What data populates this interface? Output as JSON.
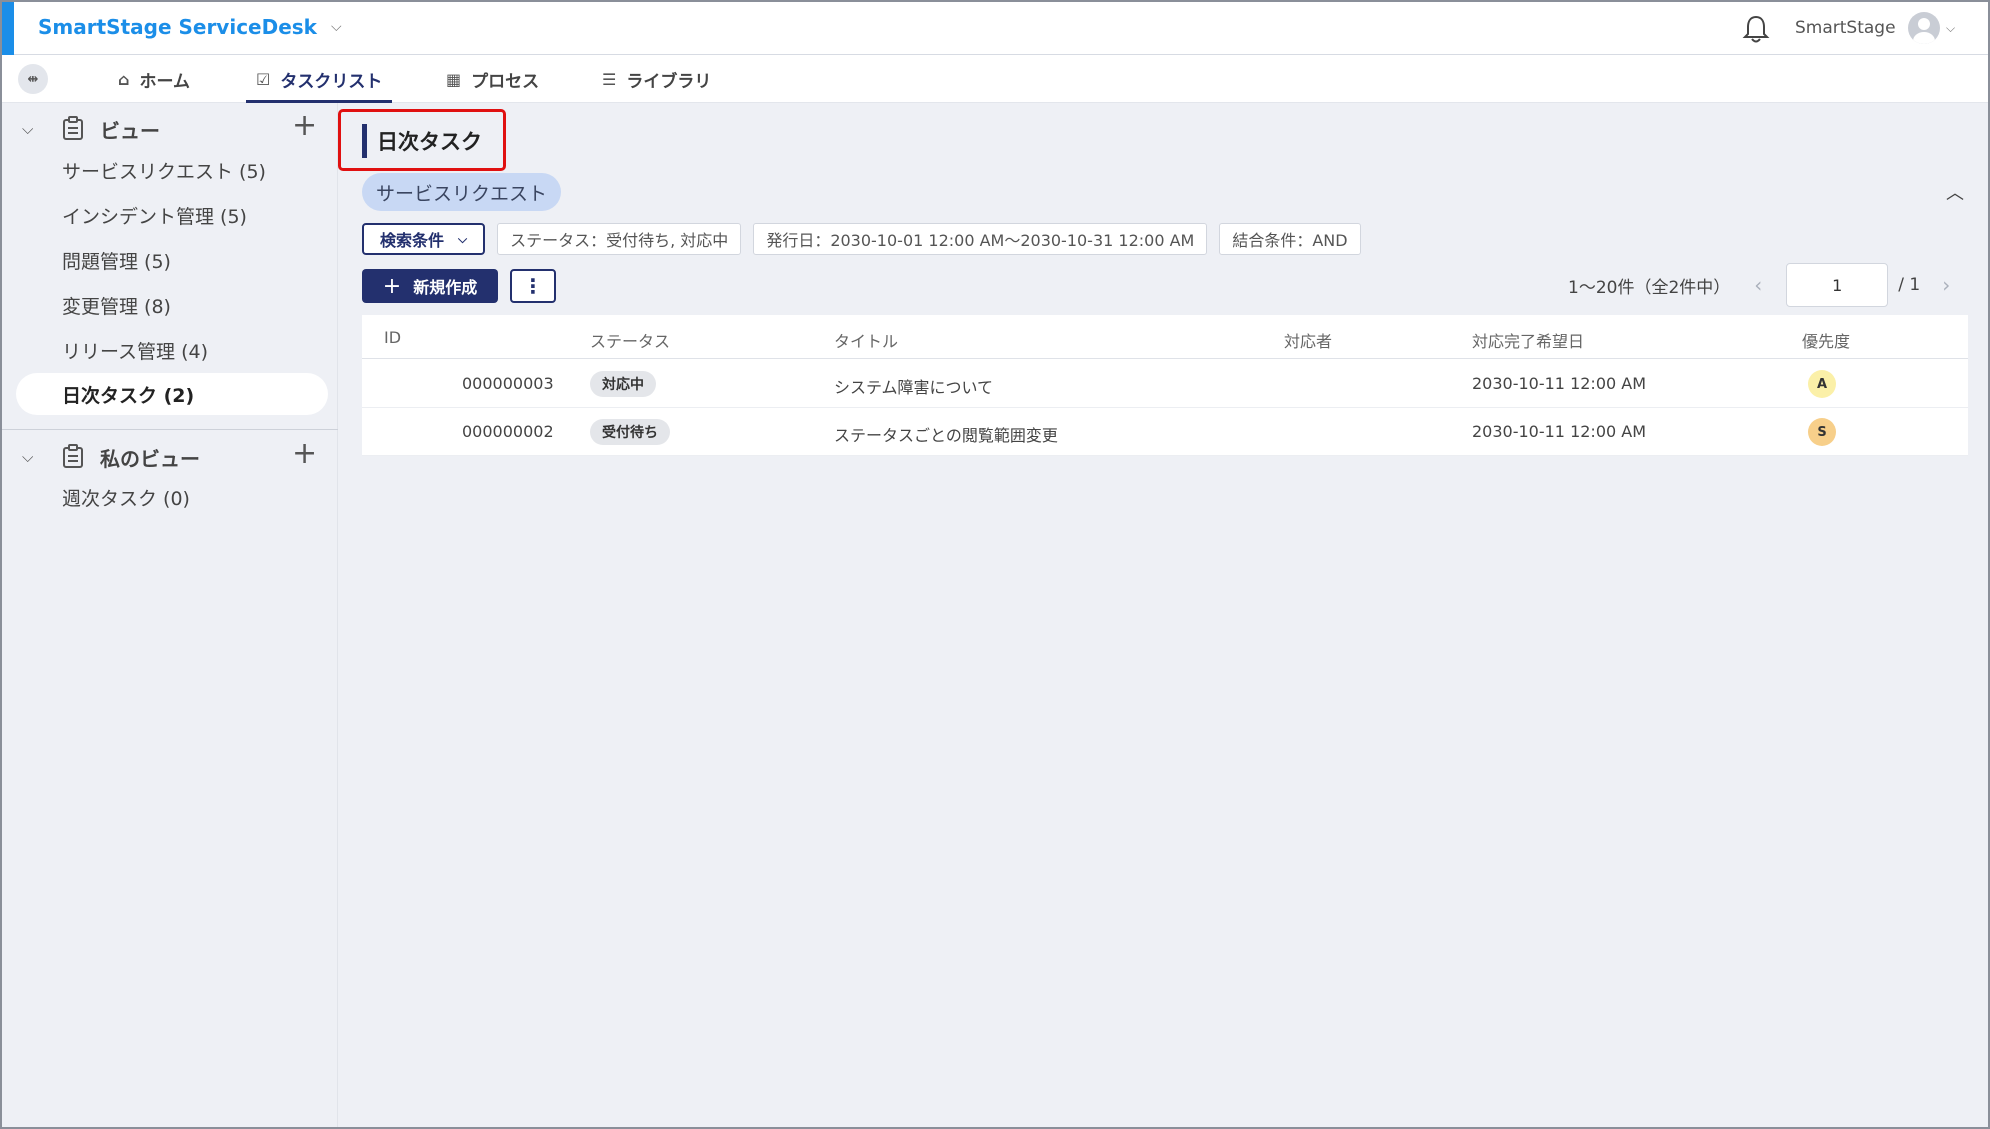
{
  "app": {
    "title": "SmartStage ServiceDesk",
    "user_name": "SmartStage"
  },
  "nav": {
    "tabs": [
      {
        "label": "ホーム",
        "icon": "home-icon"
      },
      {
        "label": "タスクリスト",
        "icon": "checklist-icon"
      },
      {
        "label": "プロセス",
        "icon": "building-icon"
      },
      {
        "label": "ライブラリ",
        "icon": "list-icon"
      }
    ]
  },
  "sidebar": {
    "views": {
      "label": "ビュー",
      "items": [
        {
          "label": "サービスリクエスト (5)"
        },
        {
          "label": "インシデント管理 (5)"
        },
        {
          "label": "問題管理 (5)"
        },
        {
          "label": "変更管理 (8)"
        },
        {
          "label": "リリース管理 (4)"
        },
        {
          "label": "日次タスク (2)"
        }
      ]
    },
    "my_views": {
      "label": "私のビュー",
      "items": [
        {
          "label": "週次タスク (0)"
        }
      ]
    }
  },
  "main": {
    "page_title": "日次タスク",
    "category_chip": "サービスリクエスト",
    "filters": {
      "search_label": "検索条件",
      "tags": [
        "ステータス：受付待ち, 対応中",
        "発行日：2030-10-01 12:00 AM〜2030-10-31 12:00 AM",
        "結合条件：AND"
      ]
    },
    "actions": {
      "new_label": "新規作成",
      "more_label": "⋮"
    },
    "pager": {
      "count": "1〜20件（全2件中）",
      "page": "1",
      "total": "/ 1"
    },
    "table": {
      "headers": [
        "ID",
        "ステータス",
        "タイトル",
        "対応者",
        "対応完了希望日",
        "優先度"
      ],
      "rows": [
        {
          "id": "000000003",
          "status": "対応中",
          "title": "システム障害について",
          "assignee": "",
          "due": "2030-10-11 12:00 AM",
          "priority": "A"
        },
        {
          "id": "000000002",
          "status": "受付待ち",
          "title": "ステータスごとの閲覧範囲変更",
          "assignee": "",
          "due": "2030-10-11 12:00 AM",
          "priority": "S"
        }
      ]
    }
  },
  "colors": {
    "brand": "#1b8ee8",
    "primary": "#23306e",
    "highlight": "#e01010",
    "priority_a": "#fbf0a8",
    "priority_s": "#f7cf8a"
  }
}
